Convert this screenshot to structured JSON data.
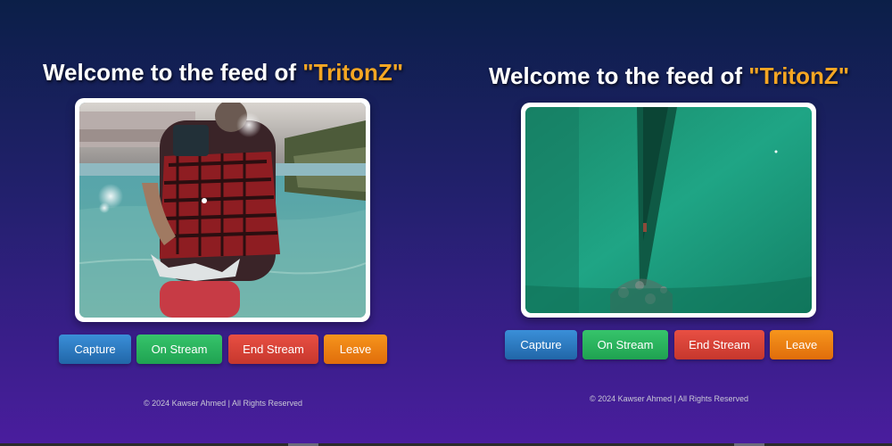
{
  "feeds": [
    {
      "title_prefix": "Welcome to the feed of ",
      "title_brand": "\"TritonZ\"",
      "buttons": {
        "capture": "Capture",
        "on_stream": "On Stream",
        "end_stream": "End Stream",
        "leave": "Leave"
      },
      "footer": "© 2024 Kawser Ahmed | All Rights Reserved"
    },
    {
      "title_prefix": "Welcome to the feed of ",
      "title_brand": "\"TritonZ\"",
      "buttons": {
        "capture": "Capture",
        "on_stream": "On Stream",
        "end_stream": "End Stream",
        "leave": "Leave"
      },
      "footer": "© 2024 Kawser Ahmed | All Rights Reserved"
    }
  ],
  "colors": {
    "brand": "#f5a623",
    "capture": "#2f7fc6",
    "on_stream": "#2bb45f",
    "end_stream": "#d9443a",
    "leave": "#ec8012"
  }
}
